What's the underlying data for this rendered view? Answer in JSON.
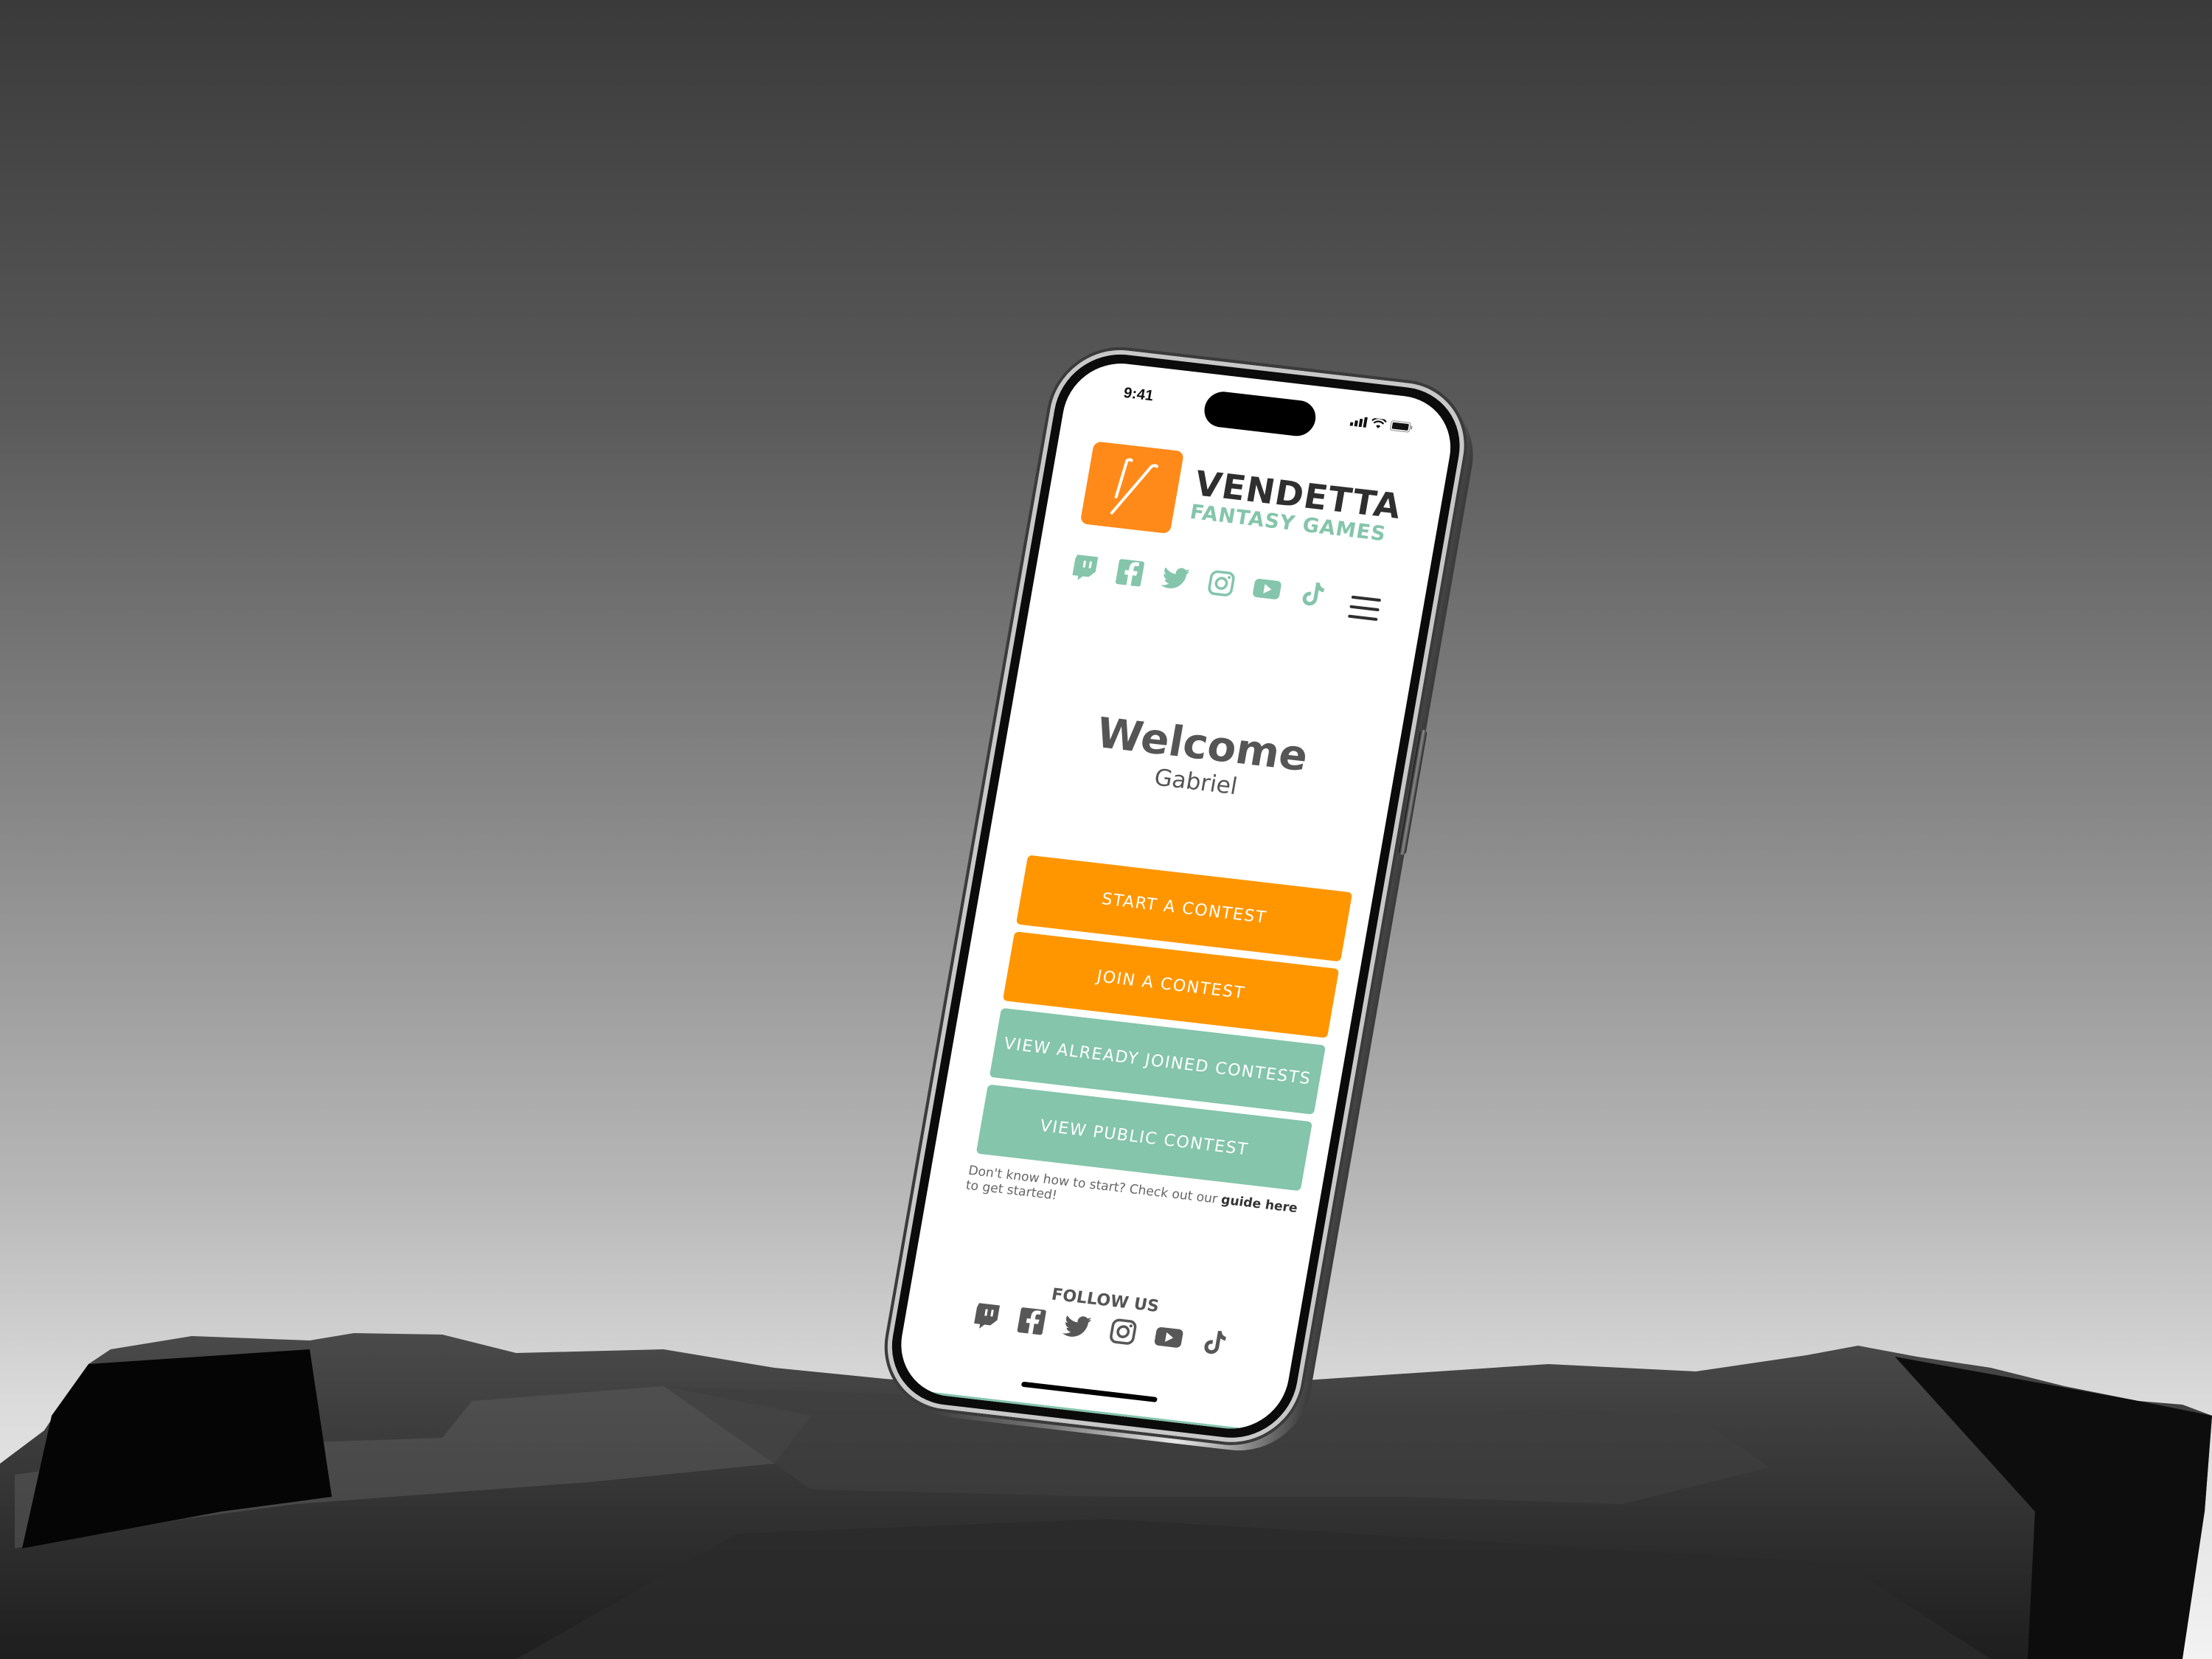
{
  "status_bar": {
    "time": "9:41",
    "icons": [
      "signal-icon",
      "wifi-icon",
      "battery-icon"
    ]
  },
  "brand": {
    "logo_letter": "V",
    "name": "VENDETTA",
    "subtitle": "FANTASY GAMES",
    "logo_color": "#ff8a1a",
    "accent_color": "#84c5ab"
  },
  "header_social": [
    "twitch-icon",
    "facebook-icon",
    "twitter-icon",
    "instagram-icon",
    "youtube-icon",
    "tiktok-icon"
  ],
  "menu_icon": "hamburger-menu-icon",
  "welcome": {
    "title": "Welcome",
    "name": "Gabriel"
  },
  "actions": [
    {
      "label": "START A CONTEST",
      "color": "#ff9600"
    },
    {
      "label": "JOIN A CONTEST",
      "color": "#ff9600"
    },
    {
      "label": "VIEW ALREADY JOINED CONTESTS",
      "color": "#84c5ab"
    },
    {
      "label": "VIEW PUBLIC CONTEST",
      "color": "#84c5ab"
    }
  ],
  "help": {
    "prefix": "Don't know how to start? Check out our ",
    "link": "guide here",
    "suffix": " to get started!"
  },
  "footer": {
    "label": "FOLLOW US",
    "social": [
      "twitch-icon",
      "facebook-icon",
      "twitter-icon",
      "instagram-icon",
      "youtube-icon",
      "tiktok-icon"
    ]
  }
}
